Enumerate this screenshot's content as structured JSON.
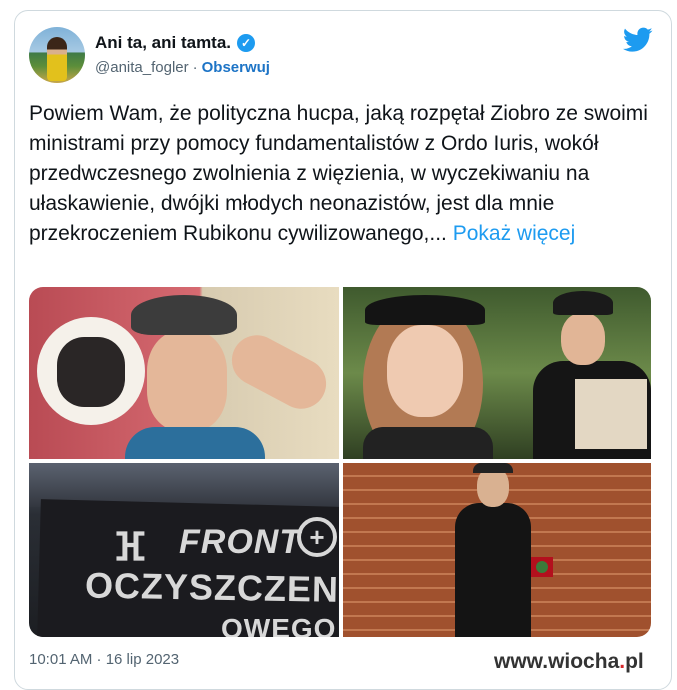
{
  "author": {
    "display_name": "Ani ta, ani tamta.",
    "handle": "@anita_fogler",
    "separator": "·",
    "follow_label": "Obserwuj",
    "verified_icon": "verified-badge-icon"
  },
  "platform_icon": "twitter-bird-icon",
  "tweet": {
    "text": "Powiem Wam, że polityczna hucpa, jaką rozpętał Ziobro ze swoimi ministrami przy pomocy fundamentalistów z Ordo Iuris, wokół przedwczesnego zwolnienia z więzienia, w wyczekiwaniu na ułaskawienie, dwójki młodych neonazistów, jest dla mnie przekroczeniem Rubikonu cywilizowanego,...",
    "show_more_label": "Pokaż więcej",
    "timestamp": "10:01 AM · 16 lip 2023"
  },
  "media": {
    "banner_line1": "FRONT",
    "banner_line2": "OCZYSZCZENIA",
    "banner_line3": "OWEGO"
  },
  "watermark": {
    "prefix": "www.",
    "site": "wiocha",
    "dot": ".",
    "tld": "pl"
  },
  "colors": {
    "accent": "#1d9bf0",
    "follow": "#1d74c6",
    "muted": "#536471"
  }
}
